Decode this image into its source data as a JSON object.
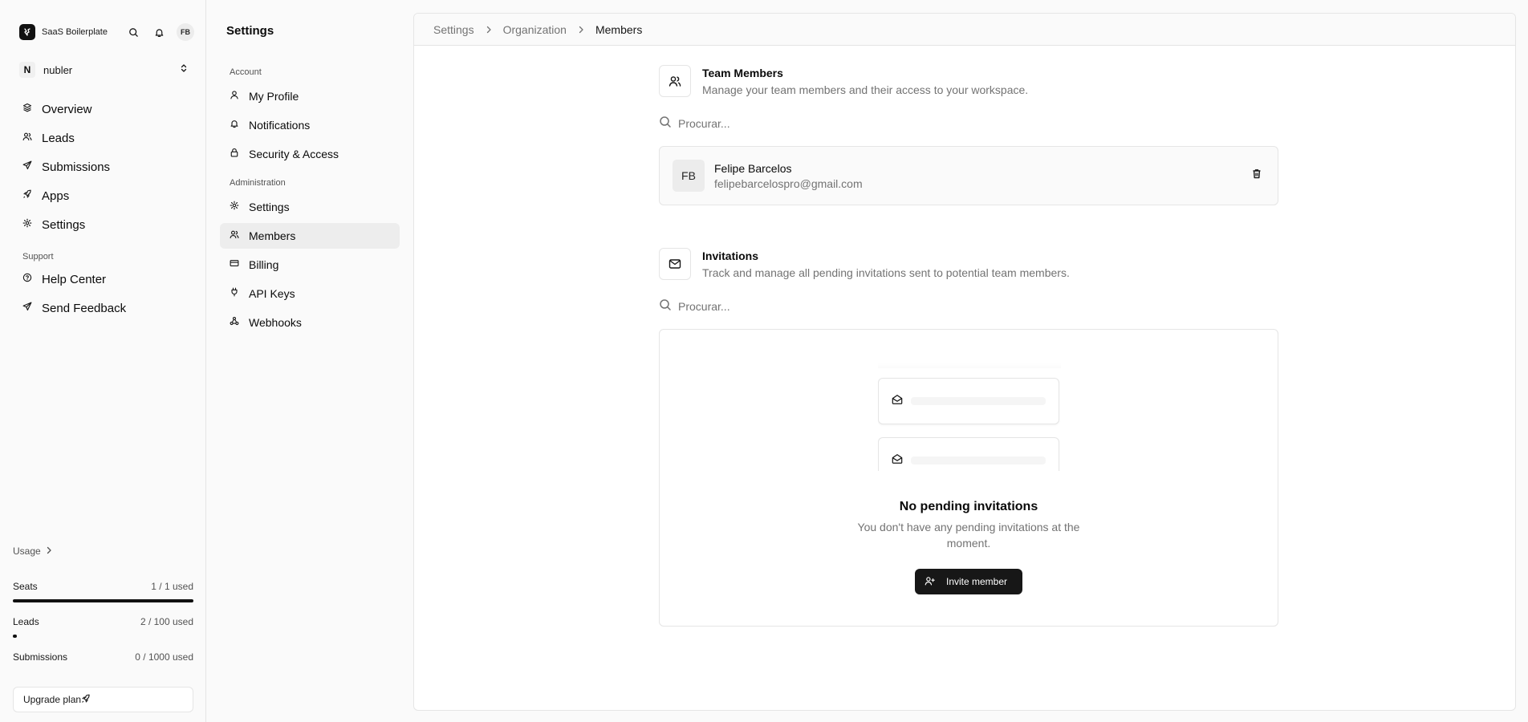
{
  "brand": {
    "name": "SaaS Boilerplate",
    "user_initials": "FB"
  },
  "org": {
    "initial": "N",
    "name": "nubler"
  },
  "nav": {
    "main": [
      {
        "label": "Overview",
        "icon": "layers-icon"
      },
      {
        "label": "Leads",
        "icon": "users-icon"
      },
      {
        "label": "Submissions",
        "icon": "send-icon"
      },
      {
        "label": "Apps",
        "icon": "rocket-icon"
      },
      {
        "label": "Settings",
        "icon": "gear-icon"
      }
    ],
    "support_heading": "Support",
    "support": [
      {
        "label": "Help Center",
        "icon": "help-circle-icon"
      },
      {
        "label": "Send Feedback",
        "icon": "send-icon"
      }
    ]
  },
  "usage": {
    "label": "Usage",
    "meters": [
      {
        "name": "Seats",
        "value": "1 / 1 used",
        "fraction": 1.0
      },
      {
        "name": "Leads",
        "value": "2 / 100 used",
        "fraction": 0.02
      },
      {
        "name": "Submissions",
        "value": "0 / 1000 used",
        "fraction": 0.0
      }
    ],
    "upgrade_label": "Upgrade plan"
  },
  "settings": {
    "title": "Settings",
    "account_heading": "Account",
    "account": [
      {
        "label": "My Profile",
        "icon": "user-icon"
      },
      {
        "label": "Notifications",
        "icon": "bell-icon"
      },
      {
        "label": "Security & Access",
        "icon": "lock-icon"
      }
    ],
    "admin_heading": "Administration",
    "admin": [
      {
        "label": "Settings",
        "icon": "gear-icon"
      },
      {
        "label": "Members",
        "icon": "users-icon",
        "active": true
      },
      {
        "label": "Billing",
        "icon": "credit-card-icon"
      },
      {
        "label": "API Keys",
        "icon": "plug-icon"
      },
      {
        "label": "Webhooks",
        "icon": "webhook-icon"
      }
    ]
  },
  "breadcrumb": [
    "Settings",
    "Organization",
    "Members"
  ],
  "team": {
    "title": "Team Members",
    "description": "Manage your team members and their access to your workspace.",
    "search_placeholder": "Procurar...",
    "members": [
      {
        "initials": "FB",
        "name": "Felipe Barcelos",
        "email": "felipebarcelospro@gmail.com"
      }
    ]
  },
  "invitations": {
    "title": "Invitations",
    "description": "Track and manage all pending invitations sent to potential team members.",
    "search_placeholder": "Procurar...",
    "empty_title": "No pending invitations",
    "empty_description": "You don't have any pending invitations at the moment.",
    "invite_label": "Invite member"
  }
}
